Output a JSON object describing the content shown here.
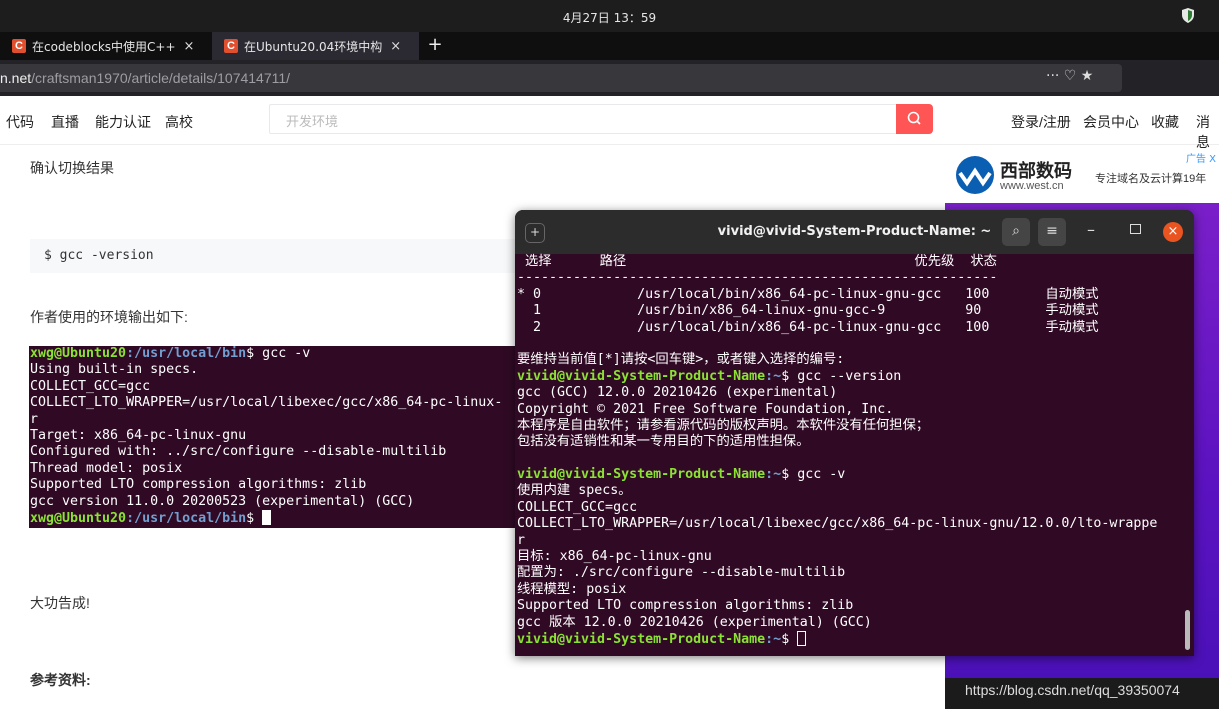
{
  "system": {
    "clock": "4月27日 13：59"
  },
  "tabs": [
    {
      "favicon": "C",
      "title": "在codeblocks中使用C++",
      "close": "×"
    },
    {
      "favicon": "C",
      "title": "在Ubuntu20.04环境中构",
      "close": "×"
    }
  ],
  "new_tab": "+",
  "address": {
    "domain": "n.net",
    "path": "/craftsman1970/article/details/107414711/",
    "icons": "··· ♡ ★"
  },
  "nav": {
    "items": [
      "代码",
      "直播",
      "能力认证",
      "高校"
    ],
    "search_placeholder": "开发环境",
    "right_items": [
      "登录/注册",
      "会员中心",
      "收藏",
      "消息"
    ]
  },
  "article": {
    "p1": "确认切换结果",
    "code1": "$ gcc -version",
    "p2": "作者使用的环境输出如下:",
    "p3": "大功告成!",
    "p4": "参考资料:"
  },
  "term1": {
    "lines": [
      {
        "prompt_user": "xwg@Ubuntu20",
        "prompt_path": ":/usr/local/bin",
        "cmd": "$ gcc -v"
      },
      {
        "text": "Using built-in specs."
      },
      {
        "text": "COLLECT_GCC=gcc"
      },
      {
        "text": "COLLECT_LTO_WRAPPER=/usr/local/libexec/gcc/x86_64-pc-linux-"
      },
      {
        "text": "r"
      },
      {
        "text": "Target: x86_64-pc-linux-gnu"
      },
      {
        "text": "Configured with: ../src/configure --disable-multilib"
      },
      {
        "text": "Thread model: posix"
      },
      {
        "text": "Supported LTO compression algorithms: zlib"
      },
      {
        "text": "gcc version 11.0.0 20200523 (experimental) (GCC)"
      },
      {
        "prompt_user": "xwg@Ubuntu20",
        "prompt_path": ":/usr/local/bin",
        "cmd": "$ "
      }
    ]
  },
  "ad": {
    "label": "广告 X",
    "brand": "西部数码",
    "url": "www.west.cn",
    "slogan": "专注域名及云计算19年",
    "watermark": "https://blog.csdn.net/qq_39350074"
  },
  "term2": {
    "title": "vivid@vivid-System-Product-Name: ~",
    "newtab_icon": "+",
    "search_icon": "⌕",
    "menu_icon": "≡",
    "min_icon": "–",
    "close_icon": "×",
    "lines": [
      {
        "text": " 选择      路径                                    优先级  状态"
      },
      {
        "text": "------------------------------------------------------------"
      },
      {
        "text": "* 0            /usr/local/bin/x86_64-pc-linux-gnu-gcc   100       自动模式"
      },
      {
        "text": "  1            /usr/bin/x86_64-linux-gnu-gcc-9          90        手动模式"
      },
      {
        "text": "  2            /usr/local/bin/x86_64-pc-linux-gnu-gcc   100       手动模式"
      },
      {
        "text": ""
      },
      {
        "text": "要维持当前值[*]请按<回车键>，或者键入选择的编号:"
      },
      {
        "prompt_user": "vivid@vivid-System-Product-Name",
        "prompt_path": ":~",
        "cmd": "$ gcc --version"
      },
      {
        "text": "gcc (GCC) 12.0.0 20210426 (experimental)"
      },
      {
        "text": "Copyright © 2021 Free Software Foundation, Inc."
      },
      {
        "text": "本程序是自由软件；请参看源代码的版权声明。本软件没有任何担保；"
      },
      {
        "text": "包括没有适销性和某一专用目的下的适用性担保。"
      },
      {
        "text": ""
      },
      {
        "prompt_user": "vivid@vivid-System-Product-Name",
        "prompt_path": ":~",
        "cmd": "$ gcc -v"
      },
      {
        "text": "使用内建 specs。"
      },
      {
        "text": "COLLECT_GCC=gcc"
      },
      {
        "text": "COLLECT_LTO_WRAPPER=/usr/local/libexec/gcc/x86_64-pc-linux-gnu/12.0.0/lto-wrappe"
      },
      {
        "text": "r"
      },
      {
        "text": "目标: x86_64-pc-linux-gnu"
      },
      {
        "text": "配置为: ./src/configure --disable-multilib"
      },
      {
        "text": "线程模型: posix"
      },
      {
        "text": "Supported LTO compression algorithms: zlib"
      },
      {
        "text": "gcc 版本 12.0.0 20210426 (experimental) (GCC)"
      },
      {
        "prompt_user": "vivid@vivid-System-Product-Name",
        "prompt_path": ":~",
        "cmd": "$ "
      }
    ]
  }
}
